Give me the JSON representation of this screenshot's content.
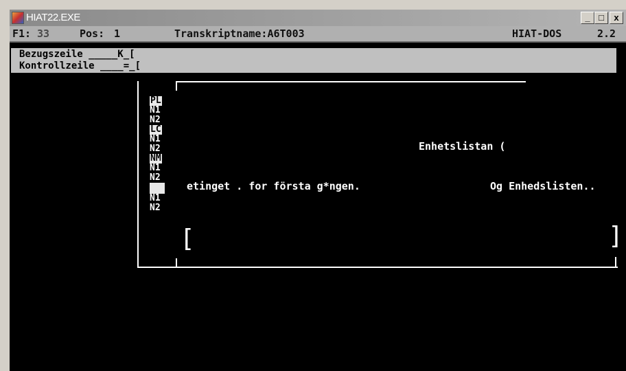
{
  "window": {
    "title": "HIAT22.EXE",
    "minimize": "_",
    "maximize": "□",
    "close": "x"
  },
  "status": {
    "fl_label": "F1:",
    "fl_value": "33",
    "pos_label": "Pos:",
    "pos_value": "1",
    "transcript": "Transkriptname:A6T003",
    "program": "HIAT-DOS",
    "version": "2.2"
  },
  "header": {
    "line1": "Bezugszeile _____K_[",
    "line2": "Kontrollzeile ____=_["
  },
  "speakers": [
    {
      "label": "PL",
      "style": "inv"
    },
    {
      "label": "N1",
      "style": "plain"
    },
    {
      "label": "N2",
      "style": "plain"
    },
    {
      "label": "LC",
      "style": "inv"
    },
    {
      "label": "N1",
      "style": "plain"
    },
    {
      "label": "N2",
      "style": "plain"
    },
    {
      "label": "NM",
      "style": "inv"
    },
    {
      "label": "N1",
      "style": "plain"
    },
    {
      "label": "N2",
      "style": "plain"
    },
    {
      "label": "",
      "style": "block"
    },
    {
      "label": "N1",
      "style": "plain"
    },
    {
      "label": "N2",
      "style": "plain"
    }
  ],
  "content": {
    "lc_text": "Enhetslistan (",
    "nm_text_left": "etinget . for första g*ngen.",
    "nm_text_right": "Og Enhedslisten..",
    "bracket_left": "[",
    "bracket_right": "]"
  }
}
